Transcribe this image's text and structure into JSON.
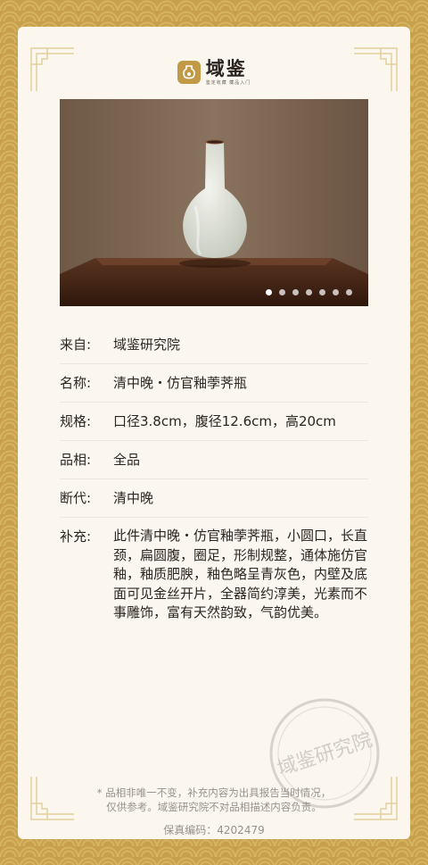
{
  "brand": {
    "name": "域鉴",
    "tagline": "鉴定收藏 藏品入门",
    "logo_icon": "vase-logo-icon",
    "color": "#c29a47"
  },
  "gallery": {
    "image_count": 7,
    "active_index": 0
  },
  "details": [
    {
      "label": "来自:",
      "value": "域鉴研究院"
    },
    {
      "label": "名称:",
      "value": "清中晚・仿官釉荸荠瓶"
    },
    {
      "label": "规格:",
      "value": "口径3.8cm，腹径12.6cm，高20cm"
    },
    {
      "label": "品相:",
      "value": "全品"
    },
    {
      "label": "断代:",
      "value": "清中晚"
    },
    {
      "label": "补充:",
      "value": "此件清中晚・仿官釉荸荠瓶，小圆口，长直颈，扁圆腹，圈足，形制规整，通体施仿官釉，釉质肥腴，釉色略呈青灰色，内壁及底面可见金丝开片，全器简约淳美，光素而不事雕饰，富有天然韵致，气韵优美。"
    }
  ],
  "seal_text": "域鉴研究院",
  "disclaimer": {
    "line1": "* 品相非唯一不变，补充内容为出具报告当时情况，",
    "line2": "仅供参考。域鉴研究院不对品相描述内容负责。"
  },
  "serial": {
    "label": "保真编码：",
    "value": "4202479"
  },
  "colors": {
    "gold_bg": "#c89f4a",
    "card": "#fbf7ee",
    "text": "#2c2522",
    "muted": "#999089"
  }
}
